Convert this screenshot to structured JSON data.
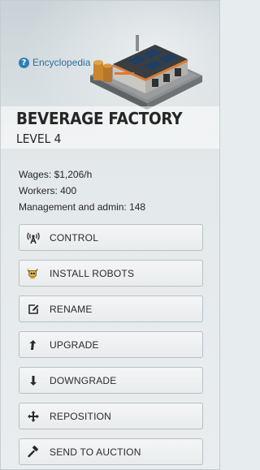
{
  "encyclopedia": {
    "icon": "question-circle-icon",
    "label": "Encyclopedia"
  },
  "building": {
    "image_icon": "beverage-factory-image",
    "title": "BEVERAGE FACTORY",
    "level": "LEVEL 4"
  },
  "stats": {
    "wages": "Wages: $1,206/h",
    "workers": "Workers: 400",
    "management": "Management and admin: 148"
  },
  "actions": [
    {
      "label": "CONTROL",
      "icon": "antenna-icon"
    },
    {
      "label": "INSTALL ROBOTS",
      "icon": "robot-icon"
    },
    {
      "label": "RENAME",
      "icon": "edit-icon"
    },
    {
      "label": "UPGRADE",
      "icon": "arrow-up-icon"
    },
    {
      "label": "DOWNGRADE",
      "icon": "arrow-down-icon"
    },
    {
      "label": "REPOSITION",
      "icon": "move-icon"
    },
    {
      "label": "SEND TO AUCTION",
      "icon": "gavel-icon"
    }
  ],
  "colors": {
    "link": "#2b6f9c",
    "text": "#262626",
    "background": "#e7ecee"
  }
}
